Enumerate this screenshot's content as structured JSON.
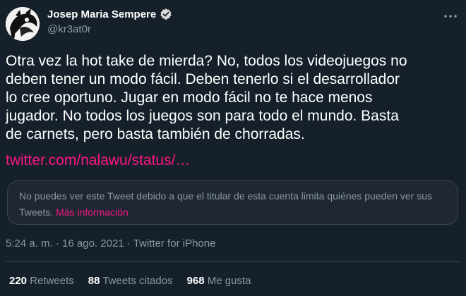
{
  "author": {
    "display_name": "Josep Maria Sempere",
    "handle": "@kr3at0r",
    "verified": true
  },
  "tweet": {
    "text": "Otra vez la hot take de mierda? No, todos los videojuegos no\ndeben tener un modo fácil. Deben tenerlo si el desarrollador\nlo cree oportuno. Jugar en modo fácil no te hace menos\njugador. No todos los juegos son para todo el mundo. Basta\nde carnets, pero basta también de chorradas.",
    "link_text": "twitter.com/nalawu/status/…"
  },
  "quoted_tweet": {
    "unavailable_text": "No puedes ver este Tweet debido a que el titular de esta cuenta limita quiénes pueden ver sus Tweets.",
    "more_info_label": "Más información"
  },
  "meta": {
    "time": "5:24 a. m.",
    "date": "16 ago. 2021",
    "separator": "·",
    "source": "Twitter for iPhone"
  },
  "stats": {
    "retweets_count": "220",
    "retweets_label": "Retweets",
    "quotes_count": "88",
    "quotes_label": "Tweets citados",
    "likes_count": "968",
    "likes_label": "Me gusta"
  },
  "icons": {
    "verified": "verified-badge-icon",
    "more": "more-options-icon"
  },
  "colors": {
    "background": "#15202b",
    "accent": "#f91880",
    "secondary_text": "#8b98a5",
    "border": "#38444d"
  }
}
